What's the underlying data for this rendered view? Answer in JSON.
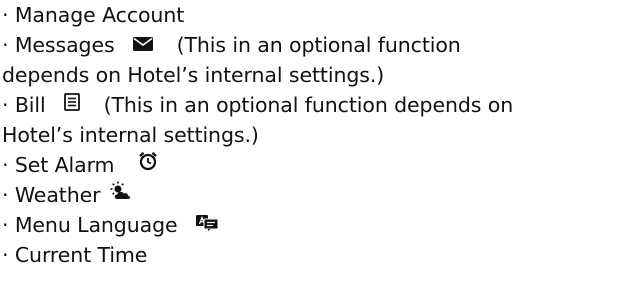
{
  "items": [
    {
      "text": "· Manage Account"
    },
    {
      "text": "· Messages",
      "icon": "envelope-icon",
      "note": "(This in an optional function"
    },
    {
      "text": "depends on Hotel’s internal settings.)"
    },
    {
      "text": "· Bill",
      "icon": "bill-icon",
      "note": "(This in an optional function depends on"
    },
    {
      "text": "Hotel’s internal settings.)"
    },
    {
      "text": "· Set Alarm",
      "icon": "alarm-clock-icon"
    },
    {
      "text": "· Weather",
      "icon": "weather-sun-cloud-icon"
    },
    {
      "text": "· Menu Language",
      "icon": "language-translate-icon"
    },
    {
      "text": "· Current Time"
    }
  ]
}
